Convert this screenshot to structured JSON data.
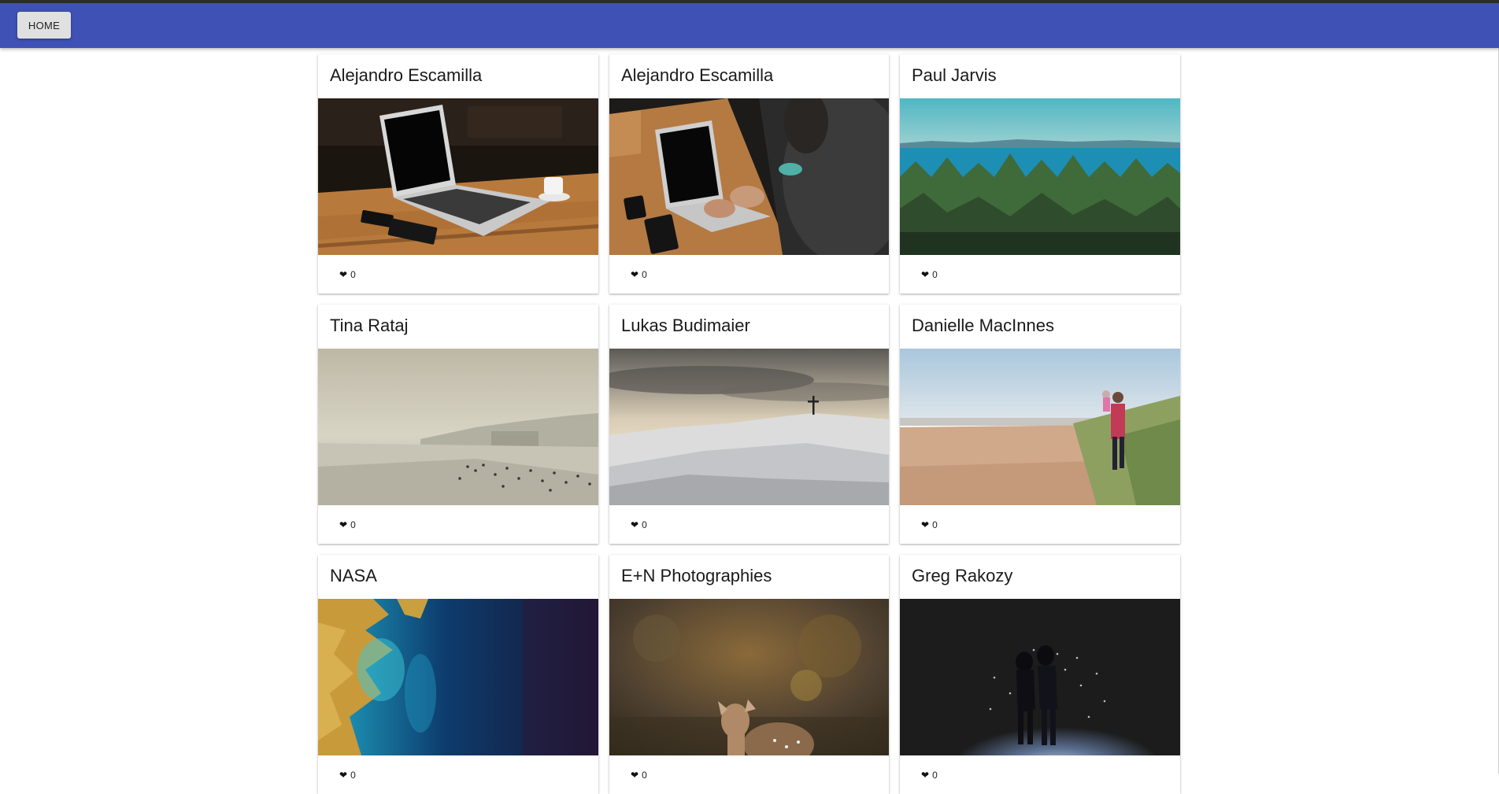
{
  "toolbar": {
    "home_label": "HOME",
    "color": "#3f51b5"
  },
  "cards": [
    {
      "author": "Alejandro Escamilla",
      "likes": "0",
      "photo": "laptop on wooden desk with coffee cup"
    },
    {
      "author": "Alejandro Escamilla",
      "likes": "0",
      "photo": "person typing on laptop at wooden table"
    },
    {
      "author": "Paul Jarvis",
      "likes": "0",
      "photo": "forest overlooking blue sea"
    },
    {
      "author": "Tina Rataj",
      "likes": "0",
      "photo": "hazy beach with crowd"
    },
    {
      "author": "Lukas Budimaier",
      "likes": "0",
      "photo": "snowy mountain summit with cross"
    },
    {
      "author": "Danielle MacInnes",
      "likes": "0",
      "photo": "man carrying child on beach path"
    },
    {
      "author": "NASA",
      "likes": "0",
      "photo": "satellite view of ocean and coast"
    },
    {
      "author": "E+N Photographies",
      "likes": "0",
      "photo": "young deer in autumn forest"
    },
    {
      "author": "Greg Rakozy",
      "likes": "0",
      "photo": "couple in dark with flashlight"
    }
  ],
  "icons": {
    "heart": "heart-icon"
  }
}
